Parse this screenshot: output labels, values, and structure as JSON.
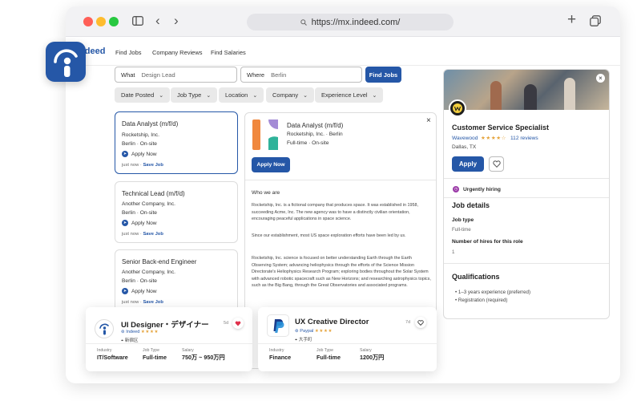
{
  "browser": {
    "url": "https://mx.indeed.com/"
  },
  "nav": {
    "logo": "indeed",
    "links": [
      "Find Jobs",
      "Company Reviews",
      "Find Salaries"
    ]
  },
  "search": {
    "what_label": "What",
    "what_value": "Design Lead",
    "where_label": "Where",
    "where_value": "Berlin",
    "button": "Find Jobs"
  },
  "filters": [
    "Date Posted",
    "Job Type",
    "Location",
    "Company",
    "Experience Level"
  ],
  "jobs": [
    {
      "title": "Data Analyst (m/f/d)",
      "company": "Rocketship, Inc.",
      "location": "Berlin · On-site",
      "apply": "Apply Now",
      "posted": "just now",
      "save": "Save Job"
    },
    {
      "title": "Technical Lead (m/f/d)",
      "company": "Another Company, Inc.",
      "location": "Berlin · On-site",
      "apply": "Apply Now",
      "posted": "just now",
      "save": "Save Job"
    },
    {
      "title": "Senior Back-end Engineer",
      "company": "Another Company, Inc.",
      "location": "Berlin · On-site",
      "apply": "Apply Now",
      "posted": "just now",
      "save": "Save Job"
    }
  ],
  "detail": {
    "title": "Data Analyst (m/f/d)",
    "company_line": "Rocketship, Inc. · Berlin",
    "type_line": "Full-time · On-site",
    "apply": "Apply Now",
    "section": "Who we are",
    "p1": "Rocketship, Inc. is a fictional company that produces space. It was established in 1958, succeeding Acme, Inc. The new agency was to have a distinctly civilian orientation, encouraging peaceful applications in space science.",
    "p2": "Since our establishment, most US space exploration efforts have been led by us.",
    "p3": "Rocketship, Inc. science is focused on better understanding Earth through the Earth Observing System; advancing heliophysics through the efforts of the Science Mission Directorate's Heliophysics Research Program; exploring bodies throughout the Solar System with advanced robotic spacecraft such as New Horizons; and researching astrophysics topics, such as the Big Bang, through the Great Observatories and associated programs."
  },
  "right_panel": {
    "title": "Customer Service Specialist",
    "company": "Wavewood",
    "rating_stars": "★★★★☆",
    "reviews": "112 reviews",
    "location": "Dallas, TX",
    "apply": "Apply",
    "urgent": "Urgently hiring",
    "job_details": "Job details",
    "job_type_label": "Job type",
    "job_type_value": "Full-time",
    "hires_label": "Number of hires for this role",
    "hires_value": "1",
    "qualifications": "Qualifications",
    "quals": [
      "1–3 years experience (preferred)",
      "Registration (required)"
    ]
  },
  "bottom_cards": [
    {
      "title": "UI Designer・デザイナー",
      "source": "Indeed",
      "stars": "★★★★",
      "place": "新宿区",
      "age": "5d",
      "industry_label": "Industry",
      "industry": "IT/Software",
      "jobtype_label": "Job Type",
      "jobtype": "Full-time",
      "salary_label": "Salary",
      "salary": "750万 ~ 950万円"
    },
    {
      "title": "UX Creative Director",
      "source": "Paypal",
      "stars": "★★★★",
      "place": "大手町",
      "age": "7d",
      "industry_label": "Industry",
      "industry": "Finance",
      "jobtype_label": "Job Type",
      "jobtype": "Full-time",
      "salary_label": "Salary",
      "salary": "1200万円"
    }
  ],
  "colors": {
    "indeed_blue": "#2557a7",
    "star": "#e5a33b",
    "urgent": "#9b3ba8",
    "heart": "#e0314b"
  }
}
